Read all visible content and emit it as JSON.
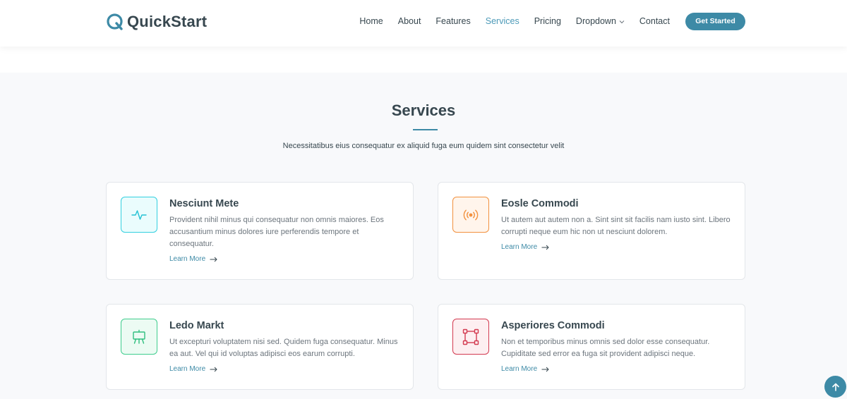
{
  "header": {
    "logo_text": "QuickStart",
    "nav": [
      {
        "label": "Home",
        "active": false
      },
      {
        "label": "About",
        "active": false
      },
      {
        "label": "Features",
        "active": false
      },
      {
        "label": "Services",
        "active": true
      },
      {
        "label": "Pricing",
        "active": false
      },
      {
        "label": "Dropdown",
        "active": false,
        "has_dropdown": true
      },
      {
        "label": "Contact",
        "active": false
      }
    ],
    "cta_label": "Get Started"
  },
  "services": {
    "title": "Services",
    "subtitle": "Necessitatibus eius consequatur ex aliquid fuga eum quidem sint consectetur velit",
    "cards": [
      {
        "icon": "activity-icon",
        "accent": "#32d0e0",
        "title": "Nesciunt Mete",
        "text": "Provident nihil minus qui consequatur non omnis maiores. Eos accusantium minus dolores iure perferendis tempore et consequatur.",
        "link": "Learn More"
      },
      {
        "icon": "broadcast-icon",
        "accent": "#f2913e",
        "title": "Eosle Commodi",
        "text": "Ut autem aut autem non a. Sint sint sit facilis nam iusto sint. Libero corrupti neque eum hic non ut nesciunt dolorem.",
        "link": "Learn More"
      },
      {
        "icon": "easel-icon",
        "accent": "#3fcd8e",
        "title": "Ledo Markt",
        "text": "Ut excepturi voluptatem nisi sed. Quidem fuga consequatur. Minus ea aut. Vel qui id voluptas adipisci eos earum corrupti.",
        "link": "Learn More"
      },
      {
        "icon": "bounding-box-icon",
        "accent": "#d33a50",
        "title": "Asperiores Commodi",
        "text": "Non et temporibus minus omnis sed dolor esse consequatur. Cupiditate sed error ea fuga sit provident adipisci neque.",
        "link": "Learn More"
      }
    ]
  },
  "colors": {
    "brand": "#3d8aa6",
    "nav_active": "#4d9ab8",
    "heading": "#37474f",
    "section_bg": "#f8f9fb"
  },
  "back_to_top_icon": "arrow-up-icon"
}
